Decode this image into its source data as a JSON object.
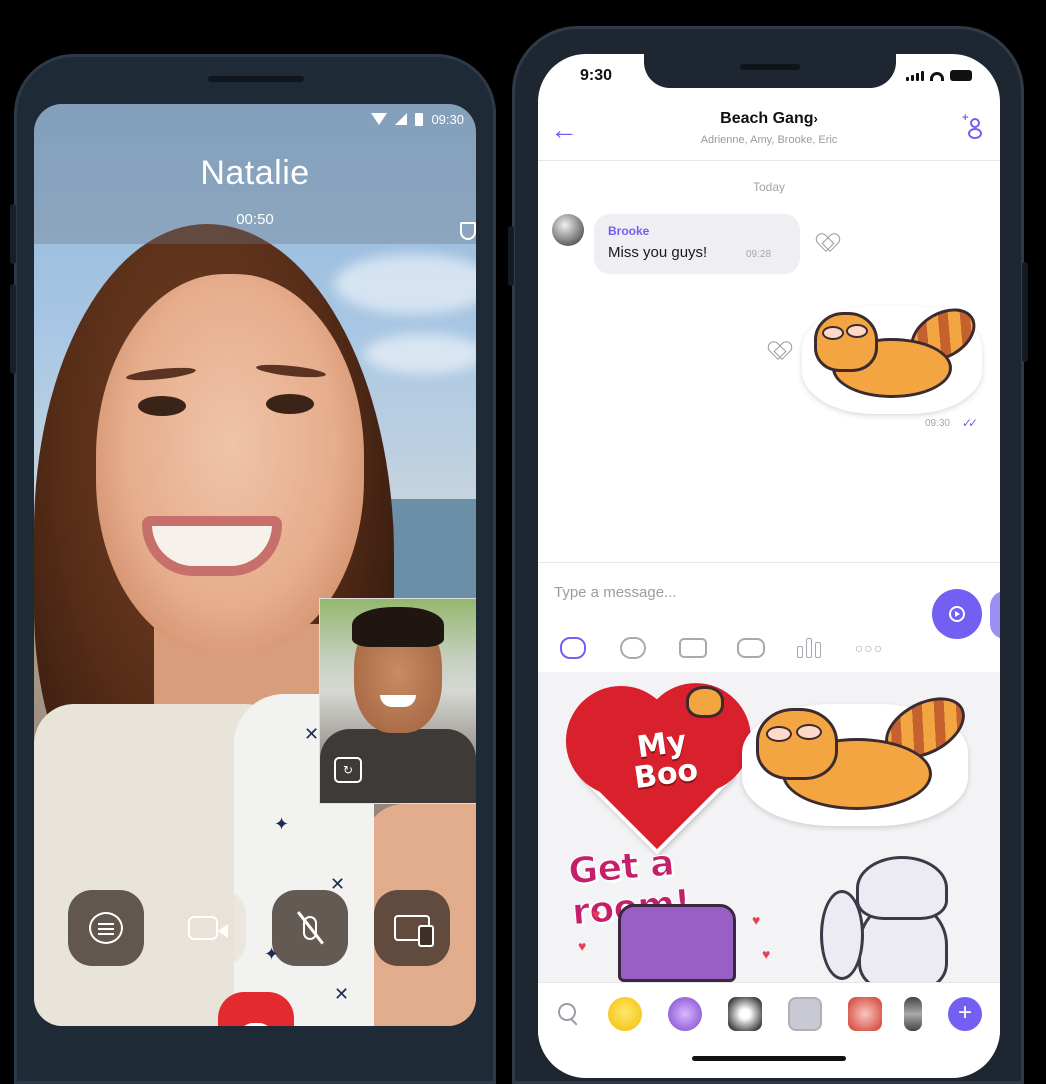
{
  "video_call": {
    "status_time": "09:30",
    "caller_name": "Natalie",
    "duration": "00:50",
    "controls": [
      "chat-icon",
      "video-icon",
      "mic-off-icon",
      "screen-share-icon"
    ],
    "end_call_color": "#e32a2f"
  },
  "chat": {
    "status_time": "9:30",
    "group_name": "Beach Gang",
    "group_chevron": "›",
    "members": "Adrienne, Amy, Brooke, Eric",
    "day_separator": "Today",
    "incoming": {
      "sender": "Brooke",
      "text": "Miss you guys!",
      "time": "09:28"
    },
    "outgoing_sticker_time": "09:30",
    "input_placeholder": "Type a message...",
    "toolbar": [
      "sticker-icon",
      "gallery-icon",
      "camera-icon",
      "gif-icon",
      "poll-icon",
      "more-icon"
    ],
    "stickers": {
      "my_boo_line1": "My",
      "my_boo_line2": "Boo",
      "get_a_room": "Get a room!"
    },
    "accent_color": "#7360f2"
  }
}
